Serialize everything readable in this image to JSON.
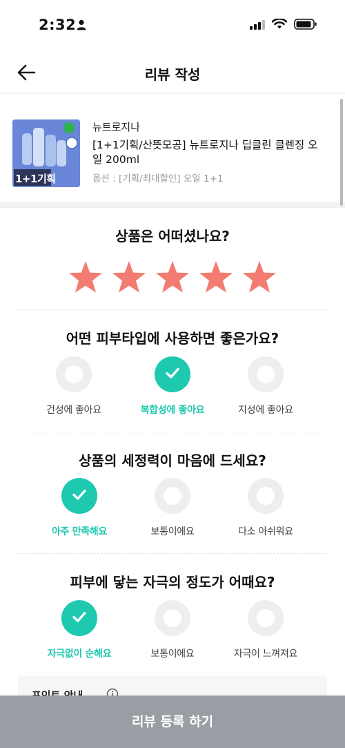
{
  "status_bar": {
    "time": "2:32",
    "icons": [
      "person-icon",
      "cellular-signal-icon",
      "wifi-icon",
      "battery-icon"
    ]
  },
  "header": {
    "title": "리뷰 작성",
    "back_icon": "arrow-left-icon"
  },
  "product": {
    "brand": "뉴트로지나",
    "name": "[1+1기획/산뜻모공] 뉴트로지나 딥클린 클렌징 오일 200ml",
    "option": "옵션 : [기획/최대할인] 오일 1+1",
    "thumbnail_text": "1+1기획"
  },
  "rating": {
    "question": "상품은 어떠셨나요?",
    "stars": 5,
    "max_stars": 5,
    "star_color": "#f27b72"
  },
  "skin_type": {
    "question": "어떤 피부타입에 사용하면 좋은가요?",
    "options": [
      {
        "label": "건성에 좋아요",
        "selected": false
      },
      {
        "label": "복합성에 좋아요",
        "selected": true
      },
      {
        "label": "지성에 좋아요",
        "selected": false
      }
    ]
  },
  "cleansing": {
    "question": "상품의 세정력이 마음에 드세요?",
    "options": [
      {
        "label": "아주 만족해요",
        "selected": true
      },
      {
        "label": "보통이에요",
        "selected": false
      },
      {
        "label": "다소 아쉬워요",
        "selected": false
      }
    ]
  },
  "irritation": {
    "question": "피부에 닿는 자극의 정도가 어때요?",
    "options": [
      {
        "label": "자극없이 순해요",
        "selected": true
      },
      {
        "label": "보통이에요",
        "selected": false
      },
      {
        "label": "자극이 느껴져요",
        "selected": false
      }
    ]
  },
  "point_notice": {
    "title": "포인트 안내"
  },
  "submit": {
    "label": "리뷰 등록 하기"
  },
  "colors": {
    "accent": "#1ec9b0",
    "button_bg": "#999ea4",
    "star": "#f27b72"
  }
}
